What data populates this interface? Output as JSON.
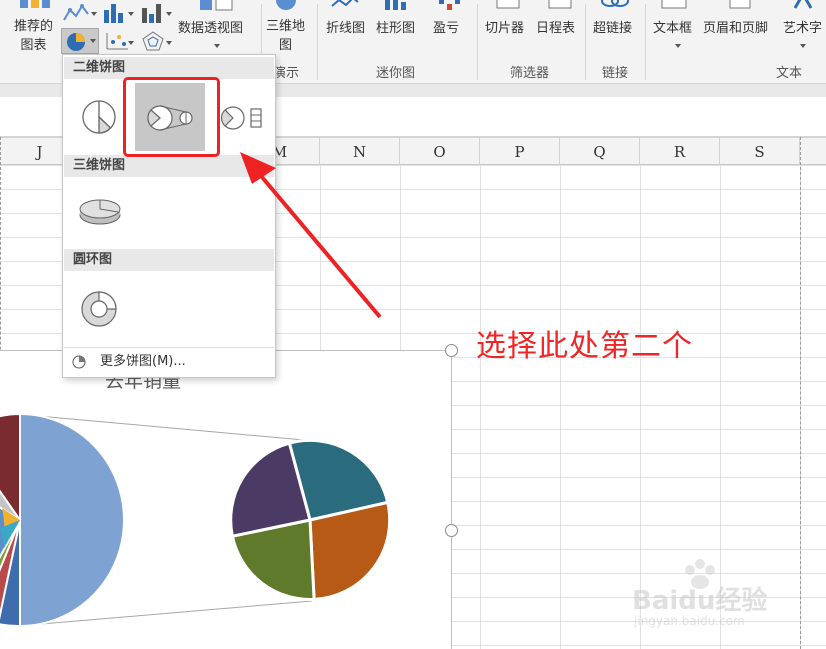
{
  "ribbon": {
    "recommended_charts": "推荐的\n图表",
    "pivot_chart": "数据透视图",
    "map_3d": "三维地\n图",
    "line": "折线图",
    "column": "柱形图",
    "win_loss": "盈亏",
    "slicer": "切片器",
    "timeline": "日程表",
    "hyperlink": "超链接",
    "textbox": "文本框",
    "header_footer": "页眉和页脚",
    "wordart": "艺术字",
    "groups": {
      "tours": "演示",
      "sparklines": "迷你图",
      "filters": "筛选器",
      "links": "链接",
      "text": "文本"
    }
  },
  "columns": [
    "J",
    "M",
    "N",
    "O",
    "P",
    "Q",
    "R",
    "S"
  ],
  "pie_dropdown": {
    "section_2d": "二维饼图",
    "section_3d": "三维饼图",
    "section_donut": "圆环图",
    "more": "更多饼图(M)...",
    "options_2d": [
      "pie",
      "pie-of-pie",
      "bar-of-pie"
    ],
    "selected_option": "pie-of-pie"
  },
  "chart": {
    "title": "去年销量"
  },
  "annotation": "选择此处第二个",
  "watermark": {
    "brand": "Baidu经验",
    "url": "jingyan.baidu.com"
  },
  "colors": {
    "highlight": "#ee2222",
    "slice_blue": "#7ea3d3",
    "slice_teal": "#2a6b7d",
    "slice_orange": "#b65a15",
    "slice_green": "#607a2c",
    "slice_purple": "#4b3a63",
    "slice_maroon": "#7a2b30"
  }
}
